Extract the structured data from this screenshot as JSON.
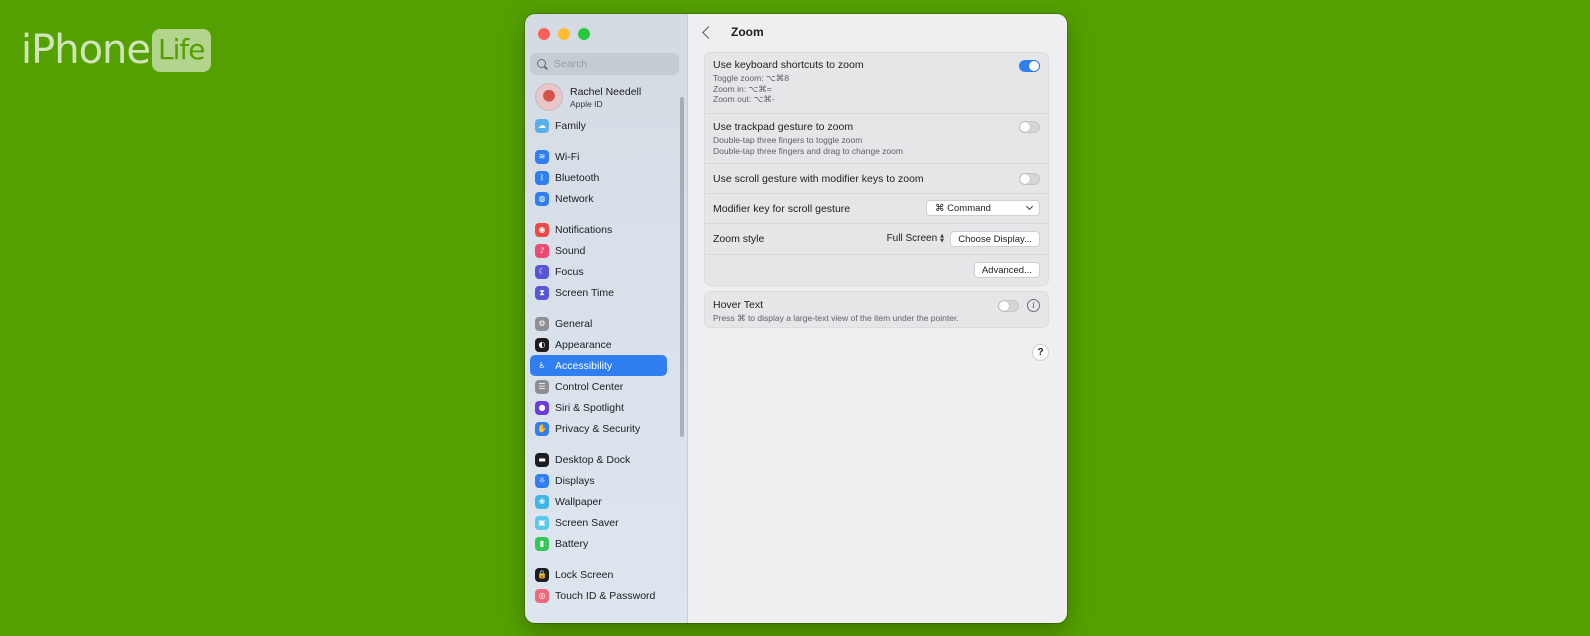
{
  "watermark": {
    "main": "iPhone",
    "badge": "Life"
  },
  "search": {
    "placeholder": "Search"
  },
  "profile": {
    "name": "Rachel Needell",
    "subtitle": "Apple ID"
  },
  "sidebar": {
    "items": [
      {
        "label": "Family",
        "icon": "family-icon",
        "color": "#5ab0ea"
      },
      {
        "label": "Wi-Fi",
        "icon": "wifi-icon",
        "color": "#2f7ff0"
      },
      {
        "label": "Bluetooth",
        "icon": "bluetooth-icon",
        "color": "#2f7ff0"
      },
      {
        "label": "Network",
        "icon": "network-icon",
        "color": "#2f7ff0"
      },
      {
        "label": "Notifications",
        "icon": "notifications-icon",
        "color": "#ec4a47"
      },
      {
        "label": "Sound",
        "icon": "sound-icon",
        "color": "#ec4a72"
      },
      {
        "label": "Focus",
        "icon": "focus-icon",
        "color": "#5a55d6"
      },
      {
        "label": "Screen Time",
        "icon": "screen-time-icon",
        "color": "#5a55d6"
      },
      {
        "label": "General",
        "icon": "general-icon",
        "color": "#8e8e93"
      },
      {
        "label": "Appearance",
        "icon": "appearance-icon",
        "color": "#1d1d1f"
      },
      {
        "label": "Accessibility",
        "icon": "accessibility-icon",
        "color": "#2f7ff0"
      },
      {
        "label": "Control Center",
        "icon": "control-center-icon",
        "color": "#8e8e93"
      },
      {
        "label": "Siri & Spotlight",
        "icon": "siri-icon",
        "color": "#6b3fd6"
      },
      {
        "label": "Privacy & Security",
        "icon": "privacy-icon",
        "color": "#2f7ff0"
      },
      {
        "label": "Desktop & Dock",
        "icon": "desktop-dock-icon",
        "color": "#1d1d1f"
      },
      {
        "label": "Displays",
        "icon": "displays-icon",
        "color": "#2f7ff0"
      },
      {
        "label": "Wallpaper",
        "icon": "wallpaper-icon",
        "color": "#3fb6e8"
      },
      {
        "label": "Screen Saver",
        "icon": "screen-saver-icon",
        "color": "#5ac8e8"
      },
      {
        "label": "Battery",
        "icon": "battery-icon",
        "color": "#34c759"
      },
      {
        "label": "Lock Screen",
        "icon": "lock-icon",
        "color": "#1d1d1f"
      },
      {
        "label": "Touch ID & Password",
        "icon": "fingerprint-icon",
        "color": "#ec6a7a"
      }
    ],
    "selected": "Accessibility"
  },
  "header": {
    "title": "Zoom"
  },
  "zoom": {
    "keyboard": {
      "title": "Use keyboard shortcuts to zoom",
      "lines": [
        "Toggle zoom: ⌥⌘8",
        "Zoom in: ⌥⌘=",
        "Zoom out: ⌥⌘-"
      ],
      "enabled": true
    },
    "trackpad": {
      "title": "Use trackpad gesture to zoom",
      "lines": [
        "Double-tap three fingers to toggle zoom",
        "Double-tap three fingers and drag to change zoom"
      ],
      "enabled": false
    },
    "scroll": {
      "title": "Use scroll gesture with modifier keys to zoom",
      "enabled": false
    },
    "modifier": {
      "title": "Modifier key for scroll gesture",
      "value": "⌘ Command"
    },
    "style": {
      "title": "Zoom style",
      "value": "Full Screen",
      "button": "Choose Display..."
    },
    "advanced": {
      "button": "Advanced..."
    }
  },
  "hover": {
    "title": "Hover Text",
    "subtitle": "Press ⌘ to display a large-text view of the item under the pointer.",
    "enabled": false
  },
  "help": {
    "label": "?"
  }
}
